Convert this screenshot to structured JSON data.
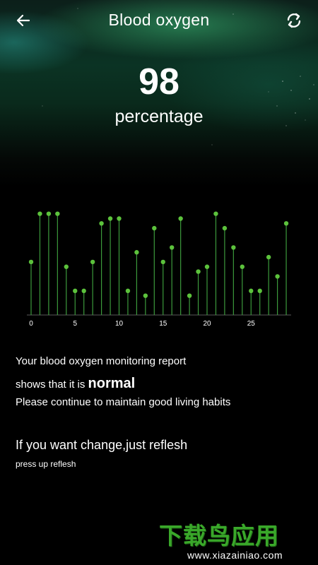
{
  "header": {
    "title": "Blood oxygen",
    "back_icon": "arrow-left-icon",
    "refresh_icon": "refresh-icon"
  },
  "reading": {
    "value": "98",
    "unit": "percentage"
  },
  "chart_data": {
    "type": "scatter",
    "style": "stem",
    "x": [
      0,
      1,
      2,
      3,
      4,
      5,
      6,
      7,
      8,
      9,
      10,
      11,
      12,
      13,
      14,
      15,
      16,
      17,
      18,
      19,
      20,
      21,
      22,
      23,
      24,
      25,
      26,
      27,
      28,
      29
    ],
    "values": [
      88,
      98,
      98,
      98,
      87,
      82,
      82,
      88,
      96,
      97,
      97,
      82,
      90,
      81,
      95,
      88,
      91,
      97,
      81,
      86,
      87,
      98,
      95,
      91,
      87,
      82,
      82,
      89,
      85,
      96
    ],
    "xticks": [
      "0",
      "5",
      "10",
      "15",
      "20",
      "25"
    ],
    "ylim": [
      77,
      100
    ],
    "grid": false,
    "colors": {
      "stem": "#3c9a3c",
      "point": "#5cc23c",
      "axis": "#5a5a5a",
      "tick_label": "#ffffff"
    }
  },
  "report": {
    "line1": "Your blood oxygen monitoring report",
    "line2_prefix": "shows that it is ",
    "status": "normal",
    "line3": "Please continue to maintain good living habits"
  },
  "refresh_hint": {
    "title": "If you want change,just reflesh",
    "subtitle": "press up reflesh"
  },
  "watermark": {
    "logo_text": "下载鸟应用",
    "url": "www.xiazainiao.com"
  }
}
